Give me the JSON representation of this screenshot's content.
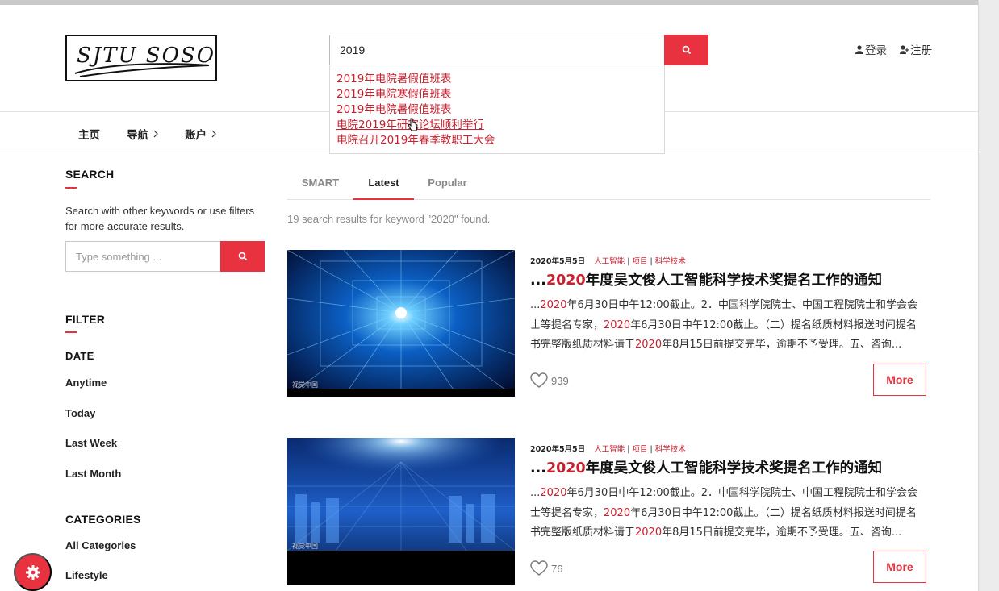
{
  "header": {
    "logo_text": "SJTU SOSO",
    "search_value": "2019",
    "login_label": "登录",
    "register_label": "注册"
  },
  "suggestions": [
    "2019年电院暑假值班表",
    "2019年电院寒假值班表",
    "2019年电院暑假值班表",
    "电院2019年研究论坛顺利举行",
    "电院召开2019年春季教职工大会"
  ],
  "nav": {
    "home": "主页",
    "navigation": "导航",
    "account": "账户"
  },
  "sidebar": {
    "search_heading": "SEARCH",
    "search_desc": "Search with other keywords or use filters for more accurate results.",
    "search_placeholder": "Type something ...",
    "filter_heading": "FILTER",
    "date_heading": "DATE",
    "date_options": [
      "Anytime",
      "Today",
      "Last Week",
      "Last Month"
    ],
    "categories_heading": "CATEGORIES",
    "categories": [
      "All Categories",
      "Lifestyle"
    ]
  },
  "tabs": [
    "SMART",
    "Latest",
    "Popular"
  ],
  "active_tab": "Latest",
  "result_count": "19 search results for keyword \"2020\" found.",
  "results": [
    {
      "date": "2020年5月5日",
      "tags": [
        "人工智能",
        "项目",
        "科学技术"
      ],
      "title_prefix": "...",
      "title_highlight": "2020",
      "title_rest": "年度吴文俊人工智能科学技术奖提名工作的通知",
      "excerpt_l1_a": "...",
      "excerpt_l1_hl": "2020",
      "excerpt_l1_b": "年6月30日中午12:00截止。2．中国科学院院士、中国工程院院士和学会会",
      "excerpt_l2_a": "士等提名专家，",
      "excerpt_l2_hl": "2020",
      "excerpt_l2_b": "年6月30日中午12:00截止。（二）提名纸质材料报送时间提名",
      "excerpt_l3_a": "书完整版纸质材料请于",
      "excerpt_l3_hl": "2020",
      "excerpt_l3_b": "年8月15日前提交完毕，逾期不予受理。五、咨询...",
      "likes": "939",
      "watermark": "视觉中国",
      "more_label": "More"
    },
    {
      "date": "2020年5月5日",
      "tags": [
        "人工智能",
        "项目",
        "科学技术"
      ],
      "title_prefix": "...",
      "title_highlight": "2020",
      "title_rest": "年度吴文俊人工智能科学技术奖提名工作的通知",
      "excerpt_l1_a": "...",
      "excerpt_l1_hl": "2020",
      "excerpt_l1_b": "年6月30日中午12:00截止。2．中国科学院院士、中国工程院院士和学会会",
      "excerpt_l2_a": "士等提名专家，",
      "excerpt_l2_hl": "2020",
      "excerpt_l2_b": "年6月30日中午12:00截止。（二）提名纸质材料报送时间提名",
      "excerpt_l3_a": "书完整版纸质材料请于",
      "excerpt_l3_hl": "2020",
      "excerpt_l3_b": "年8月15日前提交完毕，逾期不予受理。五、咨询...",
      "likes": "76",
      "watermark": "视觉中国",
      "more_label": "More"
    }
  ],
  "colors": {
    "accent": "#e8323f",
    "highlight_text": "#c8202e"
  }
}
